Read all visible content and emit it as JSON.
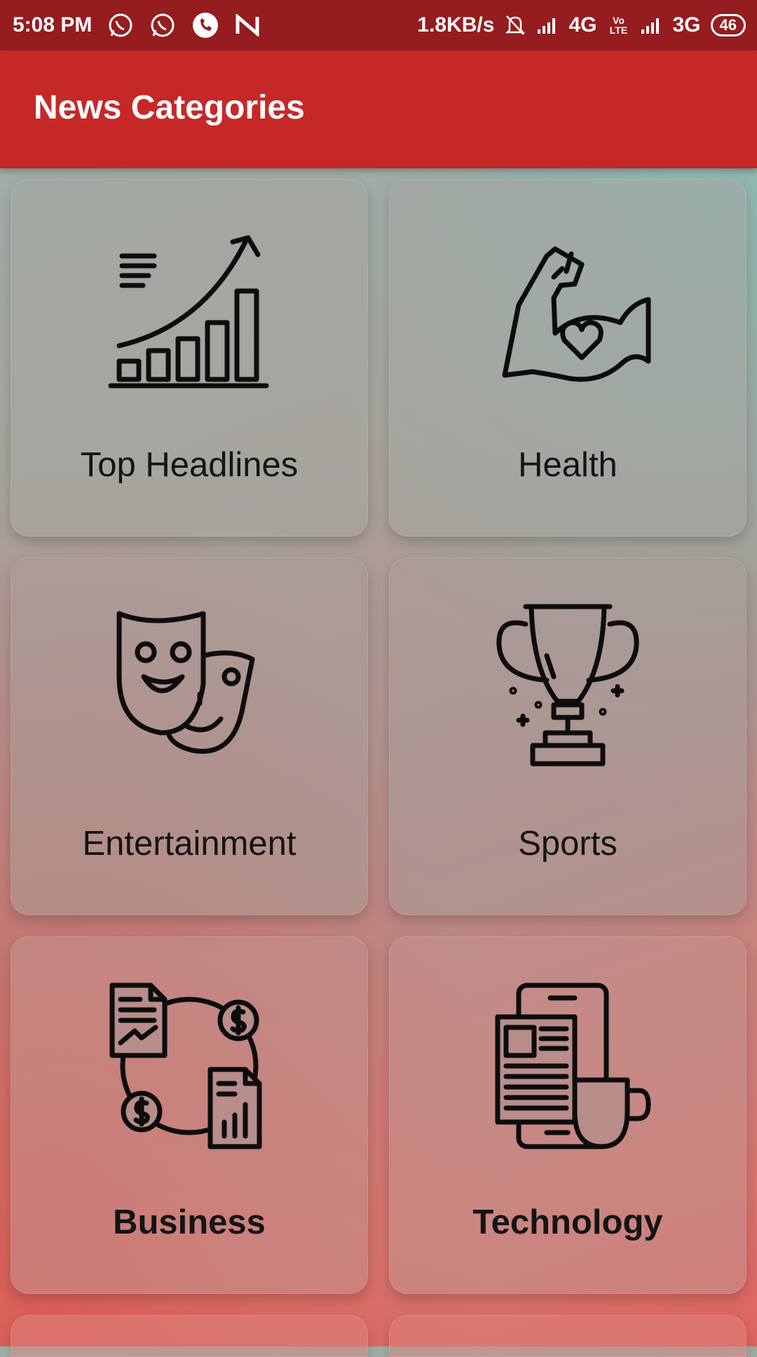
{
  "status_bar": {
    "time": "5:08 PM",
    "left_icons": [
      "whatsapp-icon",
      "whatsapp-icon",
      "phone-icon",
      "n-notification-icon"
    ],
    "network_speed": "1.8KB/s",
    "signal_1_label": "4G",
    "volte_label": "Vo LTE",
    "signal_2_label": "3G",
    "battery": "46"
  },
  "app_bar": {
    "title": "News Categories",
    "color": "#c62828"
  },
  "categories": [
    {
      "label": "Top Headlines",
      "icon": "growth-chart-icon"
    },
    {
      "label": "Health",
      "icon": "flexed-arm-heart-icon"
    },
    {
      "label": "Entertainment",
      "icon": "theater-masks-icon"
    },
    {
      "label": "Sports",
      "icon": "trophy-icon"
    },
    {
      "label": "Business",
      "icon": "business-cycle-icon"
    },
    {
      "label": "Technology",
      "icon": "phone-news-coffee-icon"
    }
  ],
  "colors": {
    "status_bar": "#951c1f",
    "app_bar": "#c62828",
    "label_text": "#141414"
  }
}
